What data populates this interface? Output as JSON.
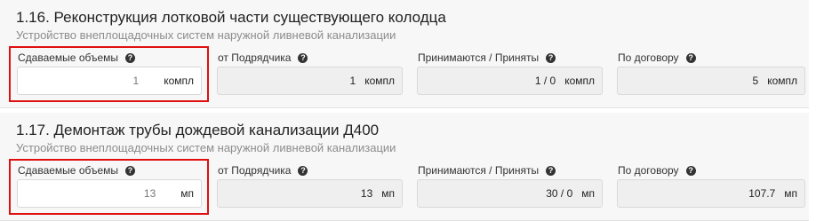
{
  "items": [
    {
      "title": "1.16. Реконструкция лотковой части существующего колодца",
      "subtitle": "Устройство внеплощадочных систем наружной ливневой канализации",
      "delivered_label": "Сдаваемые объемы",
      "delivered_value": "1",
      "delivered_unit": "компл",
      "contractor_label": "от Подрядчика",
      "contractor_value": "1",
      "contractor_unit": "компл",
      "accepted_label": "Принимаются / Приняты",
      "accepted_value": "1 / 0",
      "accepted_unit": "компл",
      "contract_label": "По договору",
      "contract_value": "5",
      "contract_unit": "компл"
    },
    {
      "title": "1.17. Демонтаж трубы дождевой канализации Д400",
      "subtitle": "Устройство внеплощадочных систем наружной ливневой канализации",
      "delivered_label": "Сдаваемые объемы",
      "delivered_value": "13",
      "delivered_unit": "мп",
      "contractor_label": "от Подрядчика",
      "contractor_value": "13",
      "contractor_unit": "мп",
      "accepted_label": "Принимаются / Приняты",
      "accepted_value": "30 / 0",
      "accepted_unit": "мп",
      "contract_label": "По договору",
      "contract_value": "107.7",
      "contract_unit": "мп"
    }
  ],
  "help_icon": "question-circle-icon",
  "colors": {
    "highlight": "#e01010",
    "readonly_bg": "#efefef",
    "section_bg": "#f7f7f7"
  }
}
